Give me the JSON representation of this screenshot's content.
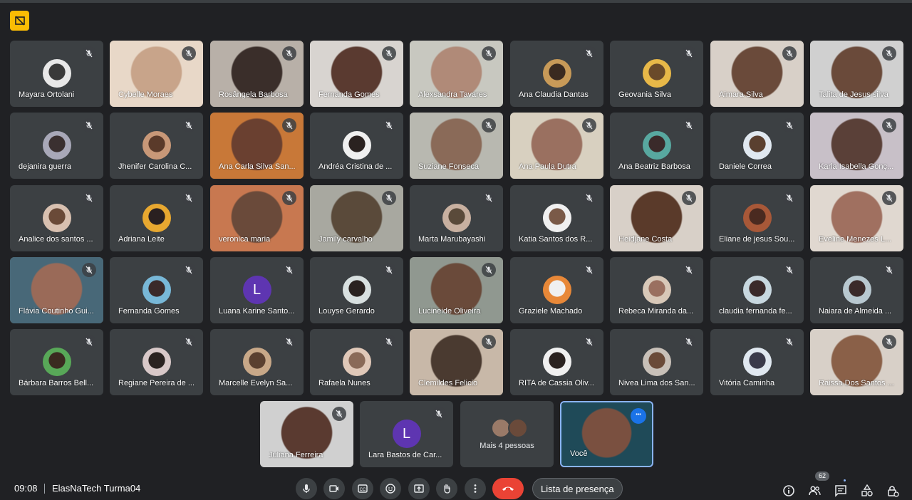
{
  "meeting": {
    "time": "09:08",
    "name": "ElasNaTech Turma04",
    "participant_count": "62"
  },
  "presence_button": "Lista de presença",
  "participants": [
    {
      "name": "Mayara Ortolani",
      "type": "avatar",
      "colors": [
        "#e8e8e8",
        "#3a3a3a"
      ]
    },
    {
      "name": "Cybelle Moraes",
      "type": "video",
      "colors": [
        "#e8d8c8",
        "#c8a48a"
      ]
    },
    {
      "name": "Rosângela Barbosa",
      "type": "video",
      "colors": [
        "#b8b0a8",
        "#3a2e2a"
      ]
    },
    {
      "name": "Fernanda Gomes",
      "type": "video",
      "colors": [
        "#d8d4d0",
        "#5a3a30"
      ]
    },
    {
      "name": "Alexsandra Tavares",
      "type": "video",
      "colors": [
        "#c8c8c0",
        "#b08a78"
      ]
    },
    {
      "name": "Ana Claudia Dantas",
      "type": "avatar",
      "colors": [
        "#c89a58",
        "#3a2a20"
      ]
    },
    {
      "name": "Geovania Silva",
      "type": "avatar",
      "colors": [
        "#e8b848",
        "#6a4a2a"
      ]
    },
    {
      "name": "Aimara Silva",
      "type": "video",
      "colors": [
        "#d8d0c8",
        "#6a4a3a"
      ]
    },
    {
      "name": "Talita de Jesus silva",
      "type": "video",
      "colors": [
        "#d0d0d0",
        "#6a4a3a"
      ]
    },
    {
      "name": "dejanira guerra",
      "type": "avatar",
      "colors": [
        "#a8a8b8",
        "#3a3030"
      ]
    },
    {
      "name": "Jhenifer Carolina C...",
      "type": "avatar",
      "colors": [
        "#c89878",
        "#5a3a2a"
      ]
    },
    {
      "name": "Ana Carla Silva San...",
      "type": "video",
      "colors": [
        "#c87838",
        "#6a4030"
      ]
    },
    {
      "name": "Andréa Cristina de ...",
      "type": "avatar",
      "colors": [
        "#f0f0f0",
        "#2a2220"
      ]
    },
    {
      "name": "Suziane Fonseca",
      "type": "video",
      "colors": [
        "#b8b8b0",
        "#8a6a58"
      ]
    },
    {
      "name": "Ana Paula Dutra",
      "type": "video",
      "colors": [
        "#d8d0c0",
        "#9a7060"
      ]
    },
    {
      "name": "Ana Beatriz Barbosa",
      "type": "avatar",
      "colors": [
        "#58a8a0",
        "#3a2a2a"
      ]
    },
    {
      "name": "Daniele Correa",
      "type": "avatar",
      "colors": [
        "#e0e8f0",
        "#5a4030"
      ]
    },
    {
      "name": "Karla Isabella Gonç...",
      "type": "video",
      "colors": [
        "#c8c0c8",
        "#5a4038"
      ]
    },
    {
      "name": "Analice dos santos ...",
      "type": "avatar",
      "colors": [
        "#d8c0b0",
        "#6a4a38"
      ]
    },
    {
      "name": "Adriana Leite",
      "type": "avatar",
      "colors": [
        "#e8a830",
        "#2a2020"
      ]
    },
    {
      "name": "veronica maria",
      "type": "video",
      "colors": [
        "#c87850",
        "#6a4a3a"
      ]
    },
    {
      "name": "Jamily carvalho",
      "type": "video",
      "colors": [
        "#a8a8a0",
        "#5a4a3a"
      ]
    },
    {
      "name": "Marta Marubayashi",
      "type": "avatar",
      "colors": [
        "#c8b0a0",
        "#5a4a3a"
      ]
    },
    {
      "name": "Katia Santos dos R...",
      "type": "avatar",
      "colors": [
        "#f0f0f0",
        "#7a5a48"
      ]
    },
    {
      "name": "Heidjane Costa",
      "type": "video",
      "colors": [
        "#d8d0c8",
        "#5a3a2a"
      ]
    },
    {
      "name": "Eliane de jesus Sou...",
      "type": "avatar",
      "colors": [
        "#a85838",
        "#4a2a20"
      ]
    },
    {
      "name": "Eveline Menezes L...",
      "type": "video",
      "colors": [
        "#e0d8d0",
        "#a07060"
      ]
    },
    {
      "name": "Flávia Coutinho Gui...",
      "type": "video",
      "colors": [
        "#486878",
        "#9a6a58"
      ]
    },
    {
      "name": "Fernanda Gomes",
      "type": "avatar",
      "colors": [
        "#78b8d8",
        "#3a2a2a"
      ]
    },
    {
      "name": "Luana Karine Santo...",
      "type": "letter",
      "letter": "L",
      "colors": [
        "#5e35b1"
      ]
    },
    {
      "name": "Louyse Gerardo",
      "type": "avatar",
      "colors": [
        "#d8e0e0",
        "#2a2220"
      ]
    },
    {
      "name": "Lucineide Oliveira",
      "type": "video",
      "colors": [
        "#909890",
        "#6a4a3a"
      ]
    },
    {
      "name": "Graziele Machado",
      "type": "avatar",
      "colors": [
        "#e88838",
        "#f0f0f0"
      ]
    },
    {
      "name": "Rebeca Miranda da...",
      "type": "avatar",
      "colors": [
        "#d8c8b8",
        "#9a7060"
      ]
    },
    {
      "name": "claudia fernanda fe...",
      "type": "avatar",
      "colors": [
        "#c8d8e0",
        "#3a2a2a"
      ]
    },
    {
      "name": "Naiara de Almeida ...",
      "type": "avatar",
      "colors": [
        "#b8c8d0",
        "#3a2a2a"
      ]
    },
    {
      "name": "Bárbara Barros Bell...",
      "type": "avatar",
      "colors": [
        "#58a858",
        "#3a2a20"
      ]
    },
    {
      "name": "Regiane Pereira de ...",
      "type": "avatar",
      "colors": [
        "#d8c8c8",
        "#2a2220"
      ]
    },
    {
      "name": "Marcelle Evelyn Sa...",
      "type": "avatar",
      "colors": [
        "#c8a888",
        "#5a4030"
      ]
    },
    {
      "name": "Rafaela Nunes",
      "type": "avatar",
      "colors": [
        "#e0c8b8",
        "#8a6a58"
      ]
    },
    {
      "name": "Clemildes Felicio",
      "type": "video",
      "colors": [
        "#c8b8a8",
        "#4a3a30"
      ]
    },
    {
      "name": "RITA de Cassia Oliv...",
      "type": "avatar",
      "colors": [
        "#f0f0f0",
        "#2a2220"
      ]
    },
    {
      "name": "Nivea Lima dos San...",
      "type": "avatar",
      "colors": [
        "#c8c0b8",
        "#6a4a38"
      ]
    },
    {
      "name": "Vitória Caminha",
      "type": "avatar",
      "colors": [
        "#e0e8f0",
        "#3a3a4a"
      ]
    },
    {
      "name": "Raissa Dos Santos ...",
      "type": "video",
      "colors": [
        "#d8d0c8",
        "#8a6048"
      ]
    }
  ],
  "bottom_row": [
    {
      "name": "Juliana Ferreira",
      "type": "video",
      "colors": [
        "#d0d0d0",
        "#5a3a30"
      ]
    },
    {
      "name": "Lara Bastos de Car...",
      "type": "letter",
      "letter": "L",
      "colors": [
        "#5e35b1"
      ]
    },
    {
      "name": "Mais 4 pessoas",
      "type": "more",
      "colors": [
        "#9a7a68",
        "#6a4a3a"
      ]
    },
    {
      "name": "Você",
      "type": "self",
      "colors": [
        "#1f4a58",
        "#7a5040"
      ]
    }
  ],
  "icons": {
    "mic": "mic-icon",
    "camera": "camera-icon",
    "captions": "captions-icon",
    "emoji": "emoji-icon",
    "present": "present-icon",
    "hand": "raise-hand-icon",
    "more": "more-options-icon",
    "end": "end-call-icon",
    "info": "info-icon",
    "people": "people-icon",
    "chat": "chat-icon",
    "activities": "activities-icon",
    "host": "host-controls-icon"
  },
  "colors": {
    "background": "#202124",
    "tile": "#3c4043",
    "end_call": "#ea4335",
    "accent": "#8ab4f8",
    "warning": "#fbbc04"
  }
}
